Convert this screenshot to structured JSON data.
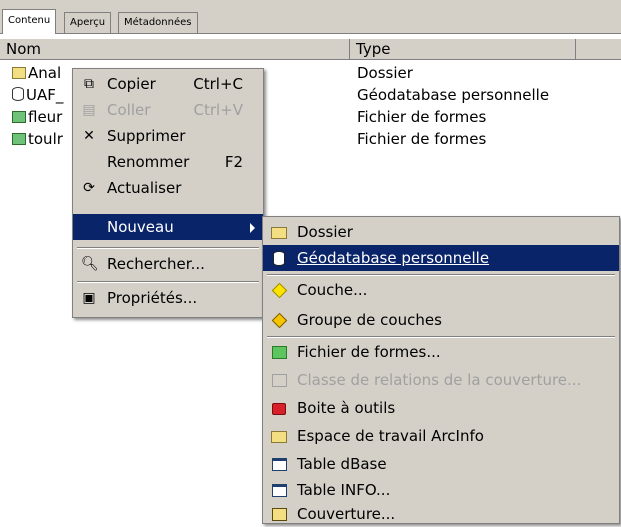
{
  "tabs": [
    {
      "label": "Contenu"
    },
    {
      "label": "Aperçu"
    },
    {
      "label": "Métadonnées"
    }
  ],
  "columns": {
    "name": "Nom",
    "type": "Type"
  },
  "rows": [
    {
      "name": "Anal",
      "type": "Dossier",
      "icon": "folder-icon"
    },
    {
      "name": "UAF_",
      "type": "Géodatabase personnelle",
      "icon": "database-icon"
    },
    {
      "name": "fleur",
      "type": "Fichier de formes",
      "icon": "shapefile-icon"
    },
    {
      "name": "toulr",
      "type": "Fichier de formes",
      "icon": "shapefile-icon"
    }
  ],
  "context_menu": {
    "copy": {
      "label": "Copier",
      "shortcut": "Ctrl+C"
    },
    "paste": {
      "label": "Coller",
      "shortcut": "Ctrl+V"
    },
    "delete": {
      "label": "Supprimer"
    },
    "rename": {
      "label": "Renommer",
      "shortcut": "F2"
    },
    "refresh": {
      "label": "Actualiser"
    },
    "new": {
      "label": "Nouveau"
    },
    "search": {
      "label": "Rechercher..."
    },
    "properties": {
      "label": "Propriétés..."
    }
  },
  "submenu": [
    {
      "label": "Dossier",
      "icon": "folder-icon"
    },
    {
      "label": "Géodatabase personnelle",
      "icon": "database-icon"
    },
    {
      "label": "Couche...",
      "icon": "layer-diamond-icon"
    },
    {
      "label": "Groupe de couches",
      "icon": "layer-group-icon"
    },
    {
      "label": "Fichier de formes...",
      "icon": "shapefile-icon"
    },
    {
      "label": "Classe de relations de la couverture...",
      "icon": "relationship-class-icon"
    },
    {
      "label": "Boite à outils",
      "icon": "toolbox-icon"
    },
    {
      "label": "Espace de travail ArcInfo",
      "icon": "workspace-folder-icon"
    },
    {
      "label": "Table dBase",
      "icon": "table-icon"
    },
    {
      "label": "Table INFO...",
      "icon": "table-icon"
    },
    {
      "label": "Couverture...",
      "icon": "coverage-icon"
    }
  ],
  "colors": {
    "selection": "#0a246a",
    "menu_bg": "#d4d0c8"
  }
}
